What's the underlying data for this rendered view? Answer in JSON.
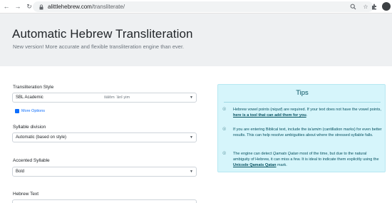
{
  "browser": {
    "url_domain": "alittlehebrew.com",
    "url_path": "/transliterate/"
  },
  "header": {
    "title": "Automatic Hebrew Transliteration",
    "subtitle": "New version! More accurate and flexible transliteration engine than ever."
  },
  "form": {
    "style_label": "Transliteration Style",
    "style_value": "SBL Academic",
    "style_hint": "šālôm  ʾănî·yim",
    "more_options": "More Options",
    "division_label": "Syllable division",
    "division_value": "Automatic (based on style)",
    "accent_label": "Accented Syllable",
    "accent_value": "Bold",
    "text_label": "Hebrew Text"
  },
  "tips": {
    "title": "Tips",
    "tip1_a": "Hebrew vowel points (",
    "tip1_italic": "niqud",
    "tip1_b": ") are required. If your text does not have the vowel points, ",
    "tip1_link": "here is a tool that can add them for you",
    "tip1_c": ".",
    "tip2_a": "If you are entering Biblical text, include the ",
    "tip2_italic": "ta'amim",
    "tip2_b": " (cantillation marks) for even better results. This can help resolve ambiguities about where the stressed syllable falls.",
    "tip3_a": "The engine can detect ",
    "tip3_italic": "Qamats Qatan",
    "tip3_b": " most of the time, but due to the natural ambiguity of Hebrew, it can miss a few. It is ideal to indicate them explicitly using the ",
    "tip3_link": "Unicode Qamats Qatan",
    "tip3_c": " mark."
  }
}
